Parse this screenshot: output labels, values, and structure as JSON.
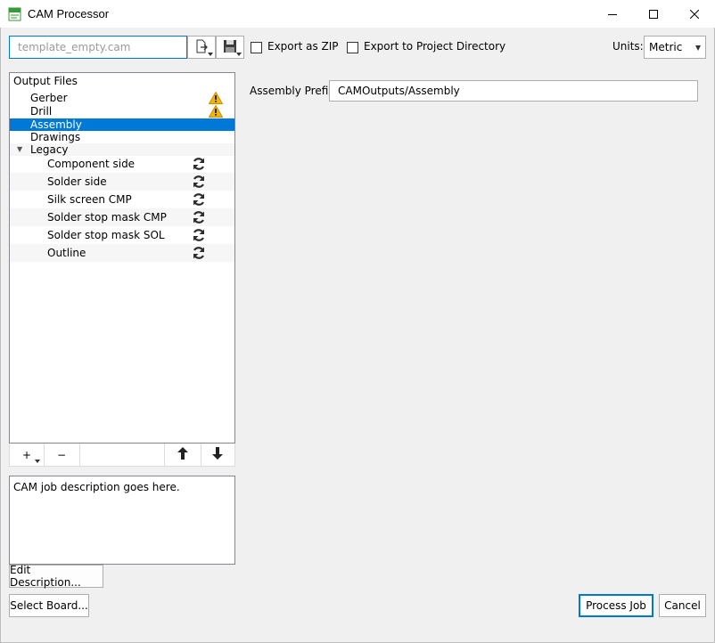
{
  "window": {
    "title": "CAM Processor",
    "app_icon": "brd-icon",
    "controls": [
      "minimize-icon",
      "maximize-icon",
      "close-icon"
    ]
  },
  "toolbar": {
    "job_file_value": "template_empty.cam",
    "open_icon": "open-job-icon",
    "save_icon": "save-disk-icon",
    "export_zip_label": "Export as ZIP",
    "export_zip_checked": false,
    "export_project_label": "Export to Project Directory",
    "export_project_checked": false,
    "units_label": "Units:",
    "units_value": "Metric"
  },
  "tree": {
    "header": "Output Files",
    "items": [
      {
        "label": "Gerber",
        "warning": true
      },
      {
        "label": "Drill",
        "warning": true
      },
      {
        "label": "Assembly",
        "selected": true
      },
      {
        "label": "Drawings"
      },
      {
        "label": "Legacy",
        "expanded": true
      }
    ],
    "legacy_children": [
      {
        "label": "Component side",
        "icon": "refresh-icon"
      },
      {
        "label": "Solder side",
        "icon": "refresh-icon"
      },
      {
        "label": "Silk screen CMP",
        "icon": "refresh-icon"
      },
      {
        "label": "Solder stop mask CMP",
        "icon": "refresh-icon"
      },
      {
        "label": "Solder stop mask SOL",
        "icon": "refresh-icon"
      },
      {
        "label": "Outline",
        "icon": "refresh-icon"
      }
    ],
    "toolbar": {
      "add_label": "+",
      "remove_label": "−",
      "up_icon": "arrow-up-icon",
      "down_icon": "arrow-down-icon"
    }
  },
  "description": {
    "text": "CAM job description goes here.",
    "edit_button": "Edit Description..."
  },
  "assembly": {
    "prefix_label": "Assembly Prefix",
    "prefix_value": "CAMOutputs/Assembly"
  },
  "footer": {
    "select_board": "Select Board...",
    "process_job": "Process Job",
    "cancel": "Cancel"
  },
  "colors": {
    "accent": "#0078d7",
    "warning": "#f2b600",
    "background": "#f0f0f0"
  }
}
